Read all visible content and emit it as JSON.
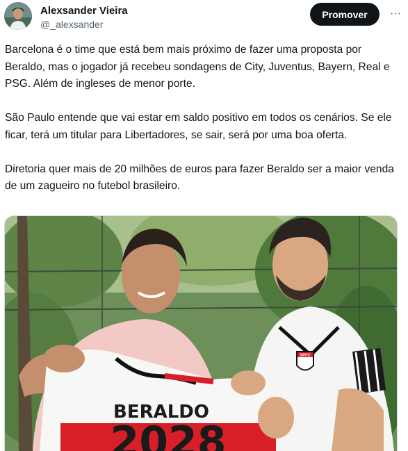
{
  "author": {
    "name": "Alexsander Vieira",
    "handle": "@_alexsander"
  },
  "actions": {
    "promote_label": "Promover",
    "more_glyph": "···"
  },
  "tweet": {
    "paragraphs": [
      "Barcelona é o time que está bem mais próximo de fazer uma proposta por Beraldo, mas o jogador já recebeu sondagens de City, Juventus, Bayern, Real e PSG. Além de ingleses de menor porte.",
      "São Paulo entende que vai estar em saldo positivo em todos os cenários. Se ele ficar, terá um titular para Libertadores, se sair, será por uma boa oferta.",
      "Diretoria quer mais de 20 milhões de euros para fazer Beraldo ser a maior venda de um zagueiro no futebol brasileiro."
    ]
  },
  "photo": {
    "shirt_name": "BERALDO",
    "shirt_number": "2028",
    "badge_text": "SPFC"
  },
  "colors": {
    "button_bg": "#0f1419",
    "handle_gray": "#536471",
    "sp_red": "#d81e28"
  },
  "icons": {
    "more": "more-dots-icon"
  }
}
